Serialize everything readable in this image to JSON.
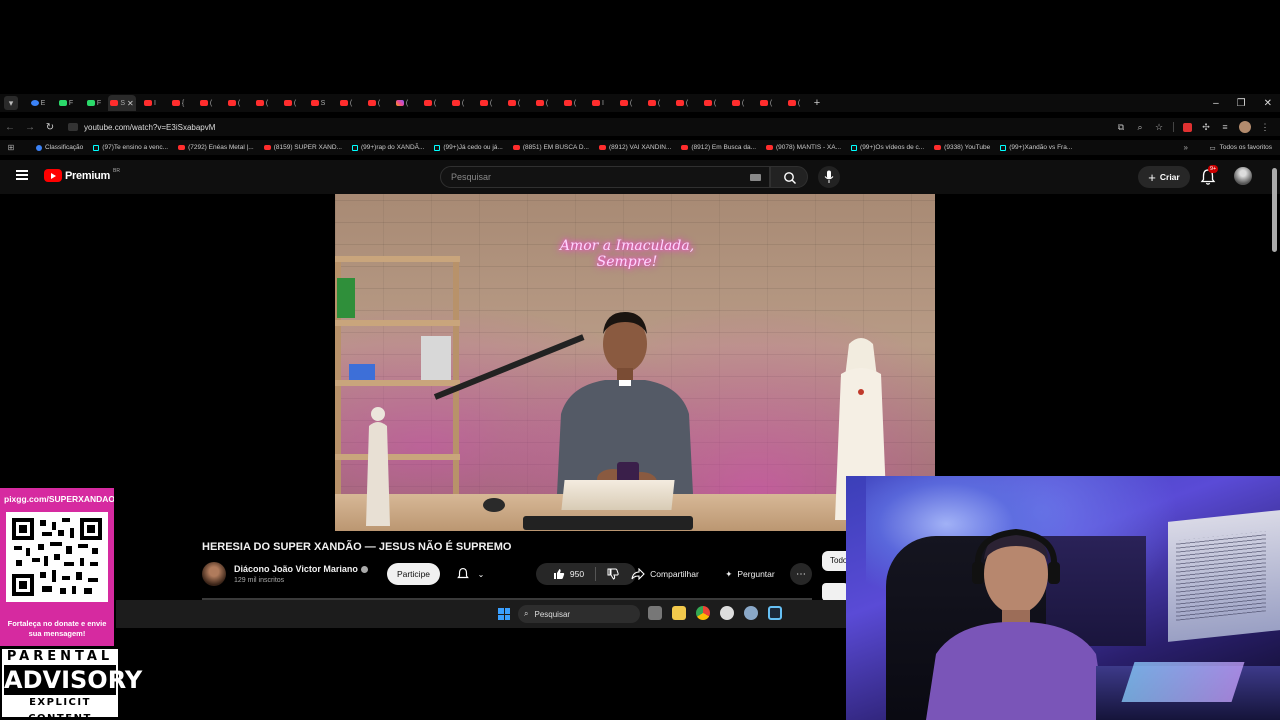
{
  "browser": {
    "url": "youtube.com/watch?v=E3iSxabapvM",
    "tabs": [
      "E",
      "F",
      "F",
      "S",
      "I",
      "{",
      "(",
      "(",
      "(",
      "(",
      "S",
      "(",
      "(",
      "(",
      "(",
      "(",
      "(",
      "(",
      "(",
      "(",
      "I",
      "(",
      "(",
      "(",
      "(",
      "(",
      "(",
      "("
    ],
    "bookmarks": [
      {
        "label": "Classificação",
        "icon": "globe-icon"
      },
      {
        "label": "(97)Te ensino a venc...",
        "icon": "tiktok-icon"
      },
      {
        "label": "(7292) Enéas Metal |...",
        "icon": "youtube-icon"
      },
      {
        "label": "(8159) SUPER XAND...",
        "icon": "youtube-icon"
      },
      {
        "label": "(99+)rap do XANDÃ...",
        "icon": "tiktok-icon"
      },
      {
        "label": "(99+)Já cedo ou já...",
        "icon": "tiktok-icon"
      },
      {
        "label": "(8851) EM BUSCA D...",
        "icon": "youtube-icon"
      },
      {
        "label": "(8912) VAI XANDIN...",
        "icon": "youtube-icon"
      },
      {
        "label": "(8912) Em Busca da...",
        "icon": "youtube-icon"
      },
      {
        "label": "(9078) MANTIS - XA...",
        "icon": "youtube-icon"
      },
      {
        "label": "(99+)Os vídeos de c...",
        "icon": "tiktok-icon"
      },
      {
        "label": "(9338) YouTube",
        "icon": "youtube-icon"
      },
      {
        "label": "(99+)Xandão vs Fra...",
        "icon": "tiktok-icon"
      }
    ],
    "all_bookmarks_label": "Todos os favoritos"
  },
  "youtube": {
    "logo_text": "Premium",
    "region": "BR",
    "search_placeholder": "Pesquisar",
    "create_label": "Criar",
    "notification_count": "9+",
    "video_overlay_text": "Amor a Imaculada, Sempre!",
    "video_title": "HERESIA DO SUPER XANDÃO — JESUS NÃO É SUPREMO",
    "channel_name": "Diácono João Victor Mariano",
    "subscribers": "129 mil inscritos",
    "join_label": "Participe",
    "likes": "950",
    "share_label": "Compartilhar",
    "ask_label": "Perguntar",
    "chip_label": "Todos"
  },
  "taskbar": {
    "search_placeholder": "Pesquisar"
  },
  "overlay": {
    "donate_url": "pixgg.com/SUPERXANDAO",
    "donate_message": "Fortaleça no donate e envie sua mensagem!",
    "advisory_line1": "PARENTAL",
    "advisory_line2": "ADVISORY",
    "advisory_line3": "EXPLICIT CONTENT"
  },
  "colors": {
    "youtube_red": "#ff0000",
    "donate_pink": "#d62aa0",
    "background": "#0f0f0f"
  }
}
